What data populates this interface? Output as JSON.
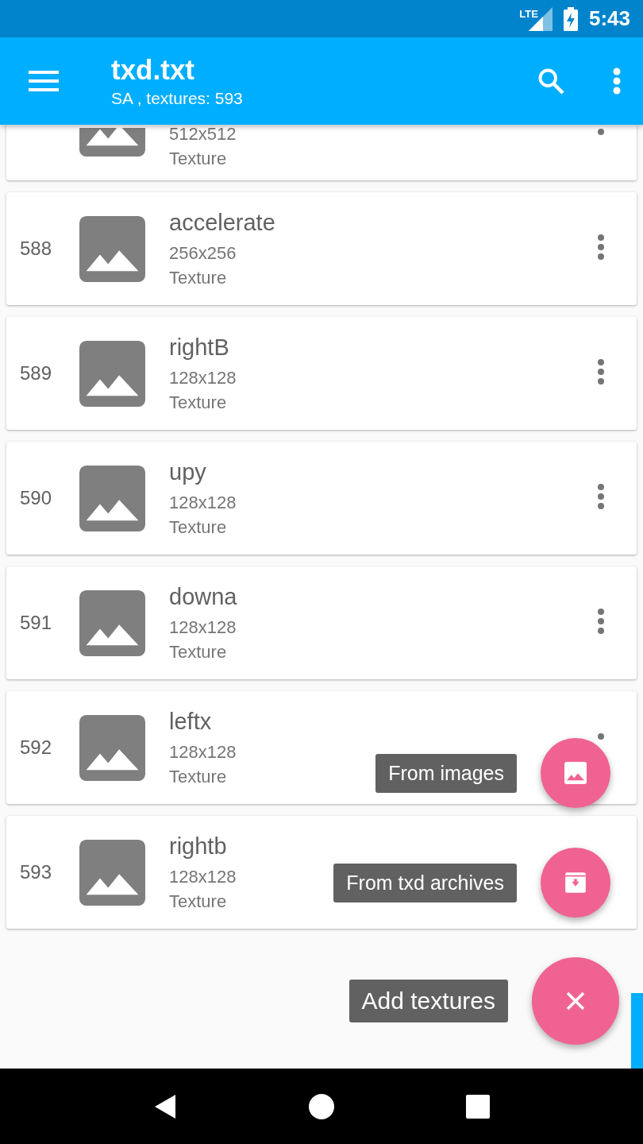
{
  "status_bar": {
    "network": "LTE",
    "time": "5:43"
  },
  "app_bar": {
    "title": "txd.txt",
    "subtitle": "SA , textures: 593"
  },
  "textures": [
    {
      "kind": "cut",
      "menu": {
        "kind": "bottom"
      },
      "size": "512x512",
      "type": "Texture"
    },
    {
      "kind": "full",
      "number": "588",
      "menu": {
        "kind": "full"
      },
      "name": "accelerate",
      "size": "256x256",
      "type": "Texture"
    },
    {
      "kind": "full",
      "number": "589",
      "menu": {
        "kind": "full"
      },
      "name": "rightB",
      "size": "128x128",
      "type": "Texture"
    },
    {
      "kind": "full",
      "number": "590",
      "menu": {
        "kind": "full"
      },
      "name": "upy",
      "size": "128x128",
      "type": "Texture"
    },
    {
      "kind": "full",
      "number": "591",
      "menu": {
        "kind": "full"
      },
      "name": "downa",
      "size": "128x128",
      "type": "Texture"
    },
    {
      "kind": "full",
      "number": "592",
      "menu": {
        "kind": "top"
      },
      "name": "leftx",
      "size": "128x128",
      "type": "Texture"
    },
    {
      "kind": "full",
      "number": "593",
      "menu": {
        "kind": "none"
      },
      "name": "rightb",
      "size": "128x128",
      "type": "Texture"
    }
  ],
  "fab_menu": {
    "expanded": true,
    "main_label": "Add textures",
    "actions": [
      {
        "kind": "images",
        "label": "From images"
      },
      {
        "kind": "archive",
        "label": "From txd archives"
      }
    ]
  }
}
